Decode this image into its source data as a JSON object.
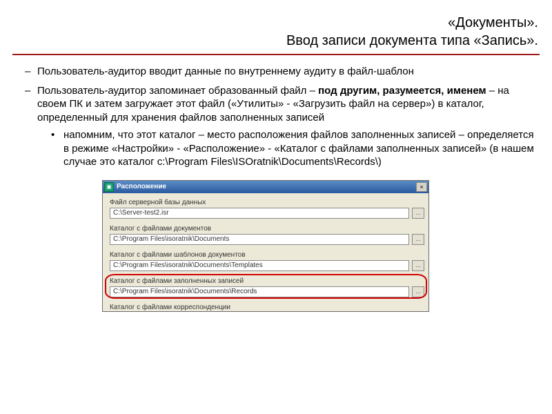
{
  "header": {
    "line1": "«Документы».",
    "line2": "Ввод записи документа типа «Запись»."
  },
  "bullets": {
    "b1": "Пользователь-аудитор вводит данные по внутреннему аудиту в файл-шаблон",
    "b2_part1": "Пользователь-аудитор запоминает образованный файл – ",
    "b2_bold": "под другим, разумеется, именем",
    "b2_part2": " – на своем ПК и затем загружает этот файл («Утилиты» - «Загрузить файл на сервер») в каталог, определенный для хранения файлов заполненных записей",
    "sub1": "напомним, что этот каталог – место расположения файлов заполненных записей – определяется в режиме «Настройки» - «Расположение» - «Каталог с файлами заполненных записей» (в нашем случае это каталог c:\\Program Files\\ISOratnik\\Documents\\Records\\)"
  },
  "dialog": {
    "title": "Расположение",
    "close": "×",
    "browse": "...",
    "fields": [
      {
        "label": "Файл серверной базы данных",
        "value": "C:\\Server-test2.isr"
      },
      {
        "label": "Каталог с файлами документов",
        "value": "C:\\Program Files\\isoratnik\\Documents"
      },
      {
        "label": "Каталог с файлами шаблонов документов",
        "value": "C:\\Program Files\\isoratnik\\Documents\\Templates"
      },
      {
        "label": "Каталог с файлами заполненных записей",
        "value": "C:\\Program Files\\isoratnik\\Documents\\Records"
      },
      {
        "label": "Каталог с файлами корреспонденции",
        "value": ""
      }
    ]
  }
}
